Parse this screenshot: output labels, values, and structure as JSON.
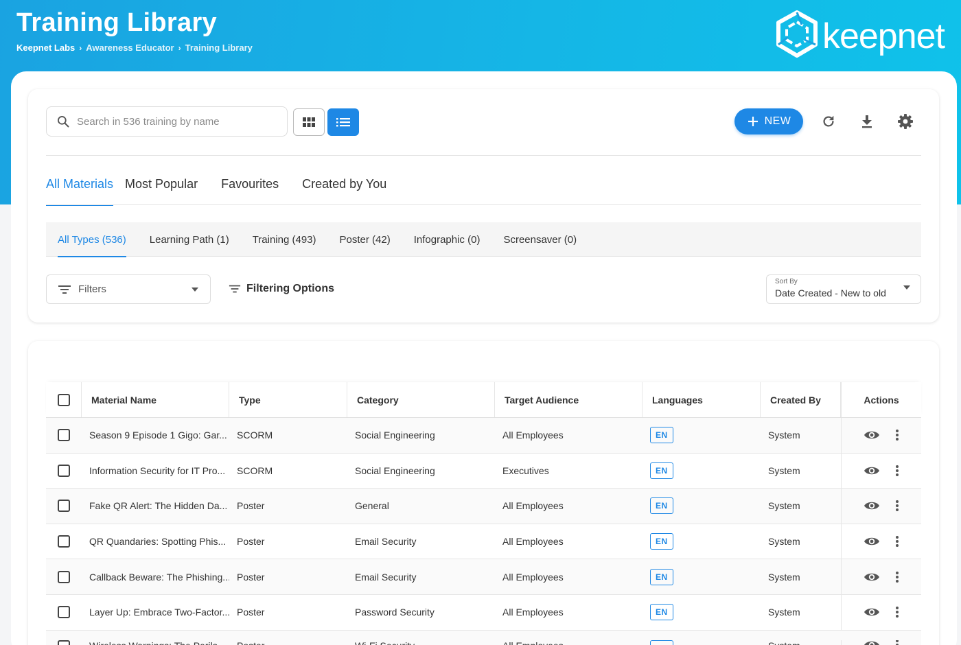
{
  "header": {
    "title": "Training Library",
    "breadcrumbs": [
      "Keepnet Labs",
      "Awareness Educator",
      "Training Library"
    ],
    "logo_text": "keepnet"
  },
  "toolbar": {
    "search_placeholder": "Search in 536 training by name",
    "new_label": "NEW"
  },
  "tabs": [
    "All Materials",
    "Most Popular",
    "Favourites",
    "Created by You"
  ],
  "types": [
    "All Types (536)",
    "Learning Path (1)",
    "Training (493)",
    "Poster (42)",
    "Infographic (0)",
    "Screensaver (0)"
  ],
  "filters": {
    "placeholder": "Filters",
    "options_label": "Filtering Options"
  },
  "sort": {
    "label": "Sort By",
    "value": "Date Created - New to old"
  },
  "table": {
    "headers": [
      "Material Name",
      "Type",
      "Category",
      "Target Audience",
      "Languages",
      "Created By",
      "Actions"
    ],
    "rows": [
      [
        "Season 9  Episode 1 Gigo: Gar...",
        "SCORM",
        "Social Engineering",
        "All Employees",
        "EN",
        "System"
      ],
      [
        "Information Security for IT Pro...",
        "SCORM",
        "Social Engineering",
        "Executives",
        "EN",
        "System"
      ],
      [
        "Fake QR Alert: The Hidden Da...",
        "Poster",
        "General",
        "All Employees",
        "EN",
        "System"
      ],
      [
        "QR Quandaries: Spotting Phis...",
        "Poster",
        "Email Security",
        "All Employees",
        "EN",
        "System"
      ],
      [
        "Callback Beware: The Phishing...",
        "Poster",
        "Email Security",
        "All Employees",
        "EN",
        "System"
      ],
      [
        "Layer Up: Embrace Two-Factor...",
        "Poster",
        "Password Security",
        "All Employees",
        "EN",
        "System"
      ],
      [
        "Wireless Warnings: The Perils...",
        "Poster",
        "Wi-Fi Security",
        "All Employees",
        "EN",
        "System"
      ]
    ]
  },
  "colors": {
    "accent": "#1e88e5",
    "hero_start": "#1aa3e1",
    "hero_end": "#0fc2ea"
  }
}
